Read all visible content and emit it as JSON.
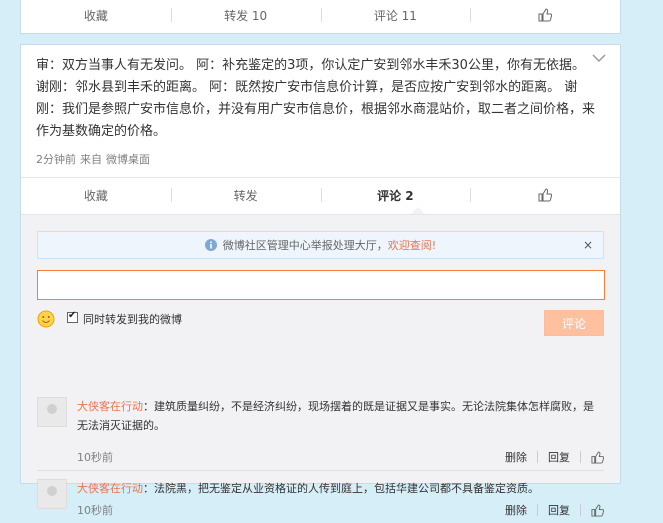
{
  "card1": {
    "actions": {
      "favorite": "收藏",
      "repost": "转发 10",
      "comment": "评论 11"
    }
  },
  "post": {
    "text": "审：双方当事人有无发问。 阿：补充鉴定的3项，你认定广安到邻水丰禾30公里，你有无依据。 谢刚：邻水县到丰禾的距离。 阿：既然按广安市信息价计算，是否应按广安到邻水的距离。 谢刚：我们是参照广安市信息价，并没有用广安市信息价，根据邻水商混站价，取二者之间价格，来作为基数确定的价格。",
    "time": "2分钟前",
    "source_prefix": "来自",
    "source": "微博桌面",
    "actions": {
      "favorite": "收藏",
      "repost": "转发",
      "comment": "评论 2"
    }
  },
  "notice": {
    "text": "微博社区管理中心举报处理大厅，",
    "link": "欢迎查阅!",
    "close": "×"
  },
  "composer": {
    "input_value": "",
    "repost_label": "同时转发到我的微博",
    "repost_checked": true,
    "submit_label": "评论"
  },
  "comments": [
    {
      "author": "大侠客在行动",
      "text": "：建筑质量纠纷，不是经济纠纷，现场摆着的既是证据又是事实。无论法院集体怎样腐败，是无法消灭证据的。",
      "time": "10秒前",
      "delete": "删除",
      "reply": "回复"
    },
    {
      "author": "大侠客在行动",
      "text": "：法院黑，把无鉴定从业资格证的人传到庭上，包括华建公司都不具备鉴定资质。",
      "time": "10秒前",
      "delete": "删除",
      "reply": "回复"
    }
  ],
  "colors": {
    "accent": "#eb7350",
    "input_border": "#fa7d3c",
    "submit_bg": "#ffc09f",
    "page_bg": "#d5eef8"
  },
  "icons": [
    "thumbs-up-icon",
    "chevron-down-icon",
    "info-icon",
    "close-icon",
    "emoji-icon",
    "avatar"
  ]
}
